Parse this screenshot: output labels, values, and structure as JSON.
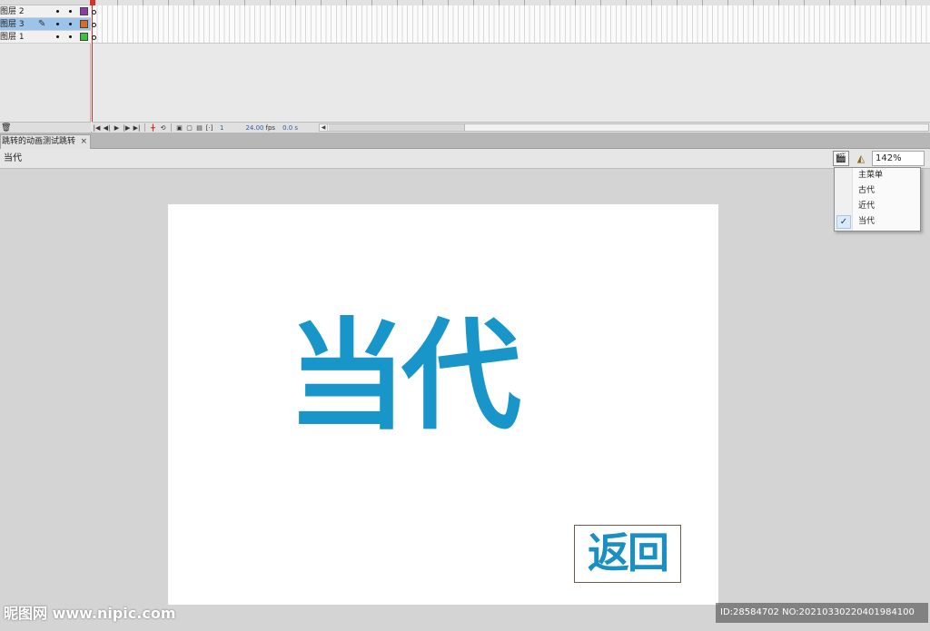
{
  "timeline": {
    "layers": [
      {
        "name": "图层 2",
        "color": "#8e3aa8",
        "selected": false
      },
      {
        "name": "图层 3",
        "color": "#e06b1c",
        "selected": true
      },
      {
        "name": "图层 1",
        "color": "#3cc33c",
        "selected": false
      }
    ],
    "controls": {
      "current_frame": "1",
      "fps": "24.00",
      "fps_unit": "fps",
      "time": "0.0 s"
    }
  },
  "document": {
    "tab_title": "跳转的动画测试跳转",
    "tab_close": "×"
  },
  "editbar": {
    "scene_name": "当代",
    "zoom": "142%"
  },
  "scene_menu": {
    "items": [
      {
        "label": "主菜单",
        "checked": false
      },
      {
        "label": "古代",
        "checked": false
      },
      {
        "label": "近代",
        "checked": false
      },
      {
        "label": "当代",
        "checked": true
      }
    ],
    "check_glyph": "✓"
  },
  "stage": {
    "title": "当代",
    "back_button": "返回"
  },
  "watermarks": {
    "left": "昵图网 www.nipic.com",
    "right": "ID:28584702 NO:20210330220401984100"
  }
}
